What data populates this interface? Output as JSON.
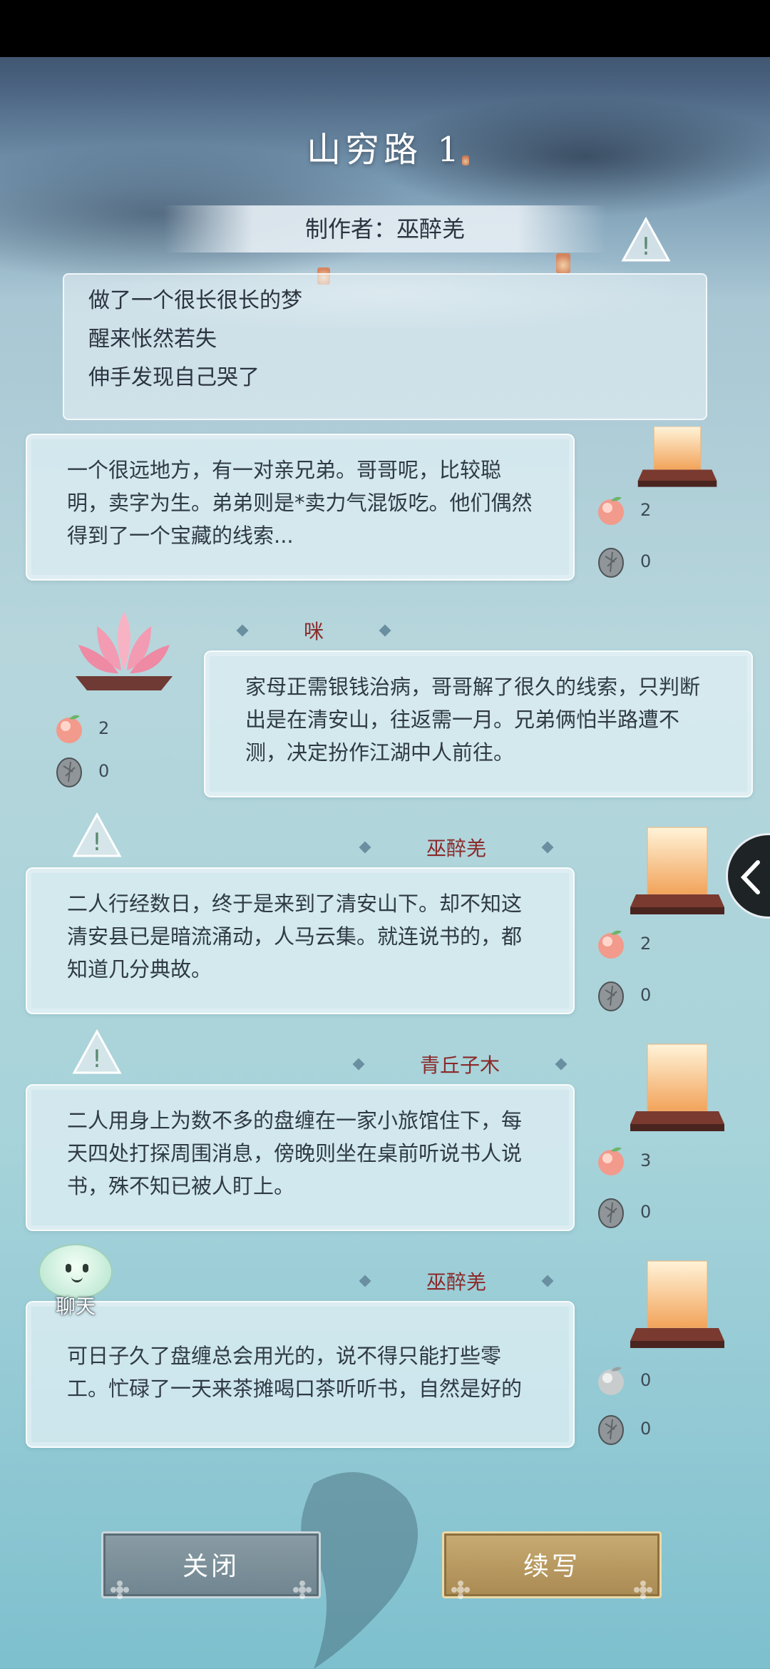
{
  "page": {
    "title": "山穷路 1",
    "author": "制作者：巫醉羌"
  },
  "summary": {
    "lines": [
      "做了一个很长很长的梦",
      "醒来怅然若失",
      "伸手发现自己哭了"
    ]
  },
  "entries": [
    {
      "author": "",
      "text": "一个很远地方，有一对亲兄弟。哥哥呢，比较聪明，卖字为生。弟弟则是*卖力气混饭吃。他们偶然得到了一个宝藏的线索...",
      "peach_count": "2",
      "stone_count": "0",
      "lantern": "square-lantern-icon"
    },
    {
      "author": "咪",
      "text": "家母正需银钱治病，哥哥解了很久的线索，只判断出是在清安山，往返需一月。兄弟俩怕半路遭不测，决定扮作江湖中人前往。",
      "peach_count": "2",
      "stone_count": "0",
      "lantern": "lotus-lantern-icon"
    },
    {
      "author": "巫醉羌",
      "text": "二人行经数日，终于是来到了清安山下。却不知这清安县已是暗流涌动，人马云集。就连说书的，都知道几分典故。",
      "peach_count": "2",
      "stone_count": "0",
      "lantern": "square-lantern-icon"
    },
    {
      "author": "青丘子木",
      "text": "二人用身上为数不多的盘缠在一家小旅馆住下，每天四处打探周围消息，傍晚则坐在桌前听说书人说书，殊不知已被人盯上。",
      "peach_count": "3",
      "stone_count": "0",
      "lantern": "square-lantern-icon"
    },
    {
      "author": "巫醉羌",
      "text": "可日子久了盘缠总会用光的，说不得只能打些零工。忙碌了一天来茶摊喝口茶听听书，自然是好的",
      "peach_count": "0",
      "stone_count": "0",
      "lantern": "square-lantern-icon"
    }
  ],
  "chat": {
    "label": "聊天"
  },
  "buttons": {
    "close": "关闭",
    "continue": "续写"
  },
  "colors": {
    "author_name": "#8a2a2a",
    "close_btn": "#7d929c",
    "continue_btn": "#b89a60"
  }
}
